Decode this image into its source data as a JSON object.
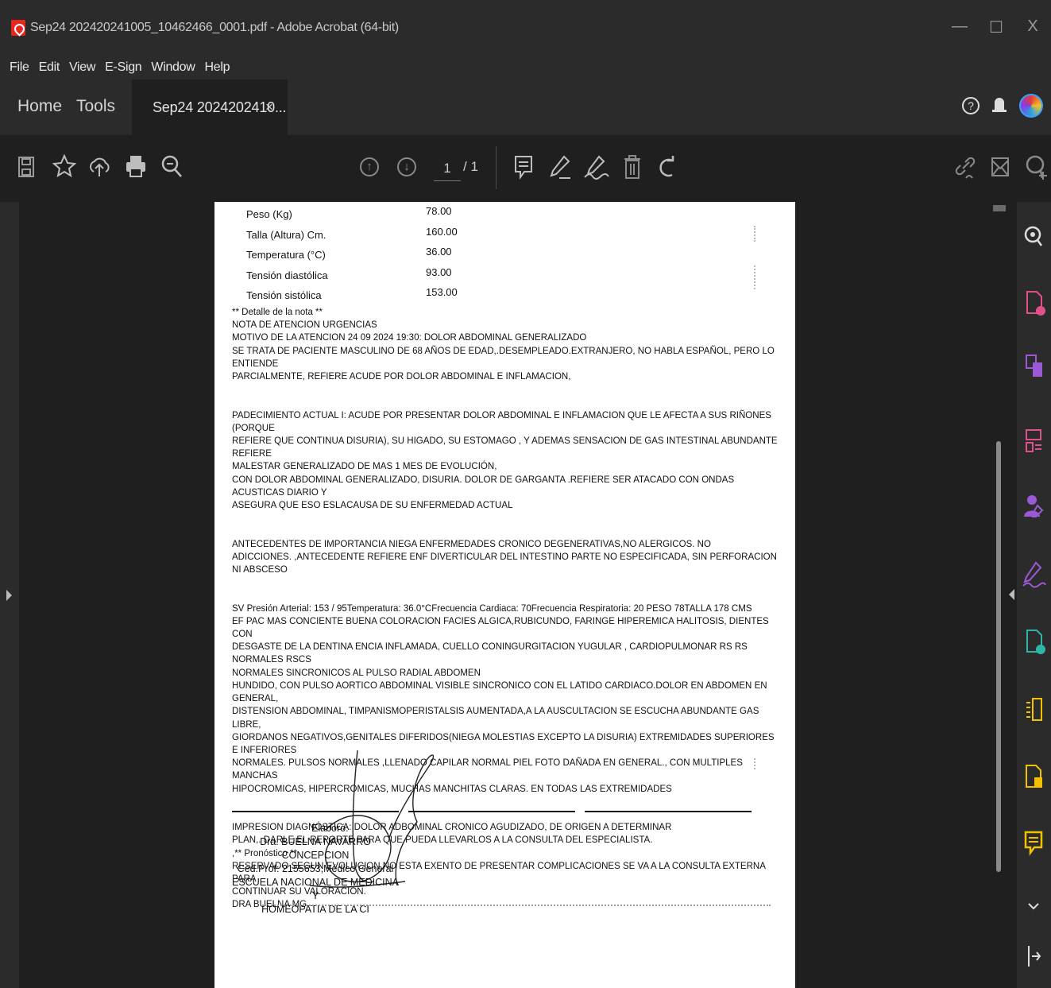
{
  "window": {
    "title": "Sep24 202420241005_10462466_0001.pdf - Adobe Acrobat (64-bit)",
    "controls": {
      "minimize": "—",
      "maximize": "☐",
      "close": "X"
    }
  },
  "menu": [
    "File",
    "Edit",
    "View",
    "E-Sign",
    "Window",
    "Help"
  ],
  "tabs": {
    "home": "Home",
    "tools": "Tools",
    "document": "Sep24 2024202410...",
    "close": "×"
  },
  "toolbar": {
    "page_current": "1",
    "page_total": "/ 1"
  },
  "icons": {
    "save": "save-icon",
    "bookmark": "star-icon",
    "upload": "cloud-upload-icon",
    "print": "print-icon",
    "find": "zoom-search-icon",
    "prev_page": "arrow-up-circle-icon",
    "next_page": "arrow-down-circle-icon",
    "comment": "comment-icon",
    "highlight": "pen-icon",
    "sign": "sign-icon",
    "delete": "trash-icon",
    "rotate": "rotate-icon",
    "share_link": "link-icon",
    "email": "mail-icon",
    "search_user": "search-add-icon"
  },
  "document": {
    "vitals": [
      {
        "label": "Peso (Kg)",
        "value": "78.00"
      },
      {
        "label": "Talla (Altura) Cm.",
        "value": "160.00"
      },
      {
        "label": "Temperatura  (°C)",
        "value": "36.00"
      },
      {
        "label": "Tensión diastólica",
        "value": "93.00"
      },
      {
        "label": "Tensión sistólica",
        "value": "153.00"
      }
    ],
    "note_header": "** Detalle de la nota **",
    "body": "NOTA DE ATENCION URGENCIAS\nMOTIVO DE LA ATENCION 24 09 2024 19:30: DOLOR ABDOMINAL GENERALIZADO\nSE TRATA DE PACIENTE MASCULINO DE 68 AÑOS DE EDAD,.DESEMPLEADO.EXTRANJERO, NO HABLA ESPAÑOL, PERO LO ENTIENDE\nPARCIALMENTE, REFIERE ACUDE POR DOLOR ABDOMINAL E INFLAMACION,\n\n\nPADECIMIENTO ACTUAL I: ACUDE POR PRESENTAR DOLOR ABDOMINAL E INFLAMACION QUE LE AFECTA A SUS RIÑONES (PORQUE\nREFIERE QUE CONTINUA DISURIA), SU HIGADO, SU ESTOMAGO , Y ADEMAS SENSACION DE GAS INTESTINAL ABUNDANTE REFIERE\nMALESTAR GENERALIZADO DE MAS 1 MES DE EVOLUCIÓN,\nCON DOLOR ABDOMINAL GENERALIZADO, DISURIA. DOLOR DE GARGANTA .REFIERE SER ATACADO CON ONDAS ACUSTICAS DIARIO Y\nASEGURA QUE ESO ESLACAUSA DE SU ENFERMEDAD ACTUAL\n\n\nANTECEDENTES DE IMPORTANCIA NIEGA ENFERMEDADES CRONICO DEGENERATIVAS,NO ALERGICOS. NO\nADICCIONES. ,ANTECEDENTE REFIERE ENF DIVERTICULAR DEL INTESTINO PARTE NO ESPECIFICADA, SIN PERFORACION NI ABSCESO\n\n\nSV Presión Arterial: 153 / 95Temperatura: 36.0°CFrecuencia Cardiaca: 70Frecuencia Respiratoria: 20 PESO 78TALLA 178 CMS\nEF PAC MAS CONCIENTE BUENA COLORACION FACIES ALGICA,RUBICUNDO, FARINGE HIPEREMICA HALITOSIS, DIENTES CON\nDESGASTE DE LA DENTINA ENCIA INFLAMADA, CUELLO CONINGURGITACION YUGULAR , CARDIOPULMONAR RS RS NORMALES RSCS\nNORMALES SINCRONICOS AL PULSO RADIAL ABDOMEN\nHUNDIDO, CON PULSO AORTICO ABDOMINAL VISIBLE SINCRONICO CON EL LATIDO CARDIACO.DOLOR EN ABDOMEN EN GENERAL,\nDISTENSION ABDOMINAL, TIMPANISMOPERISTALSIS AUMENTADA,A LA AUSCULTACION SE ESCUCHA ABUNDANTE GAS LIBRE,\nGIORDANOS NEGATIVOS,GENITALES DIFERIDOS(NIEGA MOLESTIAS EXCEPTO LA DISURIA) EXTREMIDADES SUPERIORES E INFERIORES\nNORMALES. PULSOS NORMALES ,LLENADO CAPILAR NORMAL PIEL FOTO DAÑADA EN GENERAL., CON MULTIPLES MANCHAS\nHIPOCROMICAS, HIPERCROMICAS, MUCHAS MANCHITAS CLARAS. EN TODAS LAS EXTREMIDADES\n\n\nIMPRESION DIAGNÓSTICA: DOLOR ADBOMINAL CRONICO AGUDIZADO, DE ORIGEN A DETERMINAR\nPLAN,. DARLE EL REPORTE PARA QUE PUEDA LLEVARLOS A LA CONSULTA DEL ESPECIALISTA.\n,** Pronóstico **\nRESERVADO SEGUN EVOLUCION NO ESTA EXENTO DE PRESENTAR COMPLICACIONES SE VA A LA CONSULTA EXTERNA PARA\nCONTINUAR SU VALORACION.\nDRA BUELNA MG",
    "signature_block": [
      "Elaboró:",
      "Dra. BUELNA NAVARRO CONCEPCION",
      "Ced.Prof: 2155653,Médico General",
      "ESCUELA NACIONAL DE MEDICINA Y",
      "HOMEOPATIA DE LA CI"
    ]
  },
  "right_rail": [
    "zoom-search-icon",
    "export-pdf-icon",
    "combine-files-icon",
    "organize-pages-icon",
    "request-signature-icon",
    "fill-sign-icon",
    "create-pdf-icon",
    "compress-pdf-icon",
    "edit-pdf-icon",
    "comment-icon",
    "more-tools-icon",
    "collapse-panel-icon"
  ],
  "colors": {
    "chrome_dark": "#2b2b2b",
    "canvas": "#1f1f1f",
    "acrobat_red": "#e8261d",
    "tool_pink": "#e0508a",
    "tool_purple": "#9b59d6",
    "tool_yellow": "#f2c200",
    "tool_teal": "#2fb5a8"
  }
}
